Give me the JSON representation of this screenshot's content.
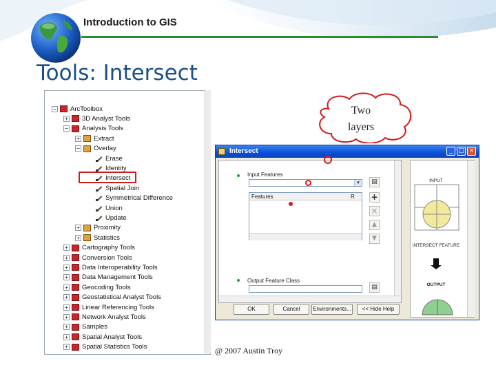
{
  "header": {
    "title": "Introduction to GIS"
  },
  "slide": {
    "title": "Tools: Intersect",
    "callout": "Two layers",
    "footer_note": "@ 2007 Austin Troy"
  },
  "toolbox": {
    "items": [
      {
        "label": "ArcToolbox",
        "expander": "−",
        "icon": "toolbox"
      },
      {
        "label": "3D Analyst Tools",
        "expander": "+",
        "icon": "toolbox"
      },
      {
        "label": "Analysis Tools",
        "expander": "−",
        "icon": "toolbox"
      },
      {
        "label": "Extract",
        "expander": "+",
        "icon": "toolset"
      },
      {
        "label": "Overlay",
        "expander": "−",
        "icon": "toolset"
      },
      {
        "label": "Erase",
        "expander": "",
        "icon": "tool"
      },
      {
        "label": "Identity",
        "expander": "",
        "icon": "tool"
      },
      {
        "label": "Intersect",
        "expander": "",
        "icon": "tool"
      },
      {
        "label": "Spatial Join",
        "expander": "",
        "icon": "tool"
      },
      {
        "label": "Symmetrical Difference",
        "expander": "",
        "icon": "tool"
      },
      {
        "label": "Union",
        "expander": "",
        "icon": "tool"
      },
      {
        "label": "Update",
        "expander": "",
        "icon": "tool"
      },
      {
        "label": "Proximity",
        "expander": "+",
        "icon": "toolset"
      },
      {
        "label": "Statistics",
        "expander": "+",
        "icon": "toolset"
      },
      {
        "label": "Cartography Tools",
        "expander": "+",
        "icon": "toolbox"
      },
      {
        "label": "Conversion Tools",
        "expander": "+",
        "icon": "toolbox"
      },
      {
        "label": "Data Interoperability Tools",
        "expander": "+",
        "icon": "toolbox"
      },
      {
        "label": "Data Management Tools",
        "expander": "+",
        "icon": "toolbox"
      },
      {
        "label": "Geocoding Tools",
        "expander": "+",
        "icon": "toolbox"
      },
      {
        "label": "Geostatistical Analyst Tools",
        "expander": "+",
        "icon": "toolbox"
      },
      {
        "label": "Linear Referencing Tools",
        "expander": "+",
        "icon": "toolbox"
      },
      {
        "label": "Network Analyst Tools",
        "expander": "+",
        "icon": "toolbox"
      },
      {
        "label": "Samples",
        "expander": "+",
        "icon": "toolbox"
      },
      {
        "label": "Spatial Analyst Tools",
        "expander": "+",
        "icon": "toolbox"
      },
      {
        "label": "Spatial Statistics Tools",
        "expander": "+",
        "icon": "toolbox"
      }
    ],
    "selected": "Intersect"
  },
  "dialog": {
    "title": "Intersect",
    "input_features_label": "Input Features",
    "column_features": "Features",
    "column_rank": "R",
    "output_label": "Output Feature Class",
    "buttons": {
      "ok": "OK",
      "cancel": "Cancel",
      "environments": "Environments...",
      "hide_help": "<< Hide Help"
    },
    "diagram": {
      "input": "INPUT",
      "intersect_feature": "INTERSECT FEATURE",
      "output": "OUTPUT"
    }
  },
  "colors": {
    "accent_green": "#2e8b2e",
    "title_blue": "#1c4f86",
    "highlight_red": "#d21a1a",
    "xp_blue": "#0a4fd6"
  }
}
